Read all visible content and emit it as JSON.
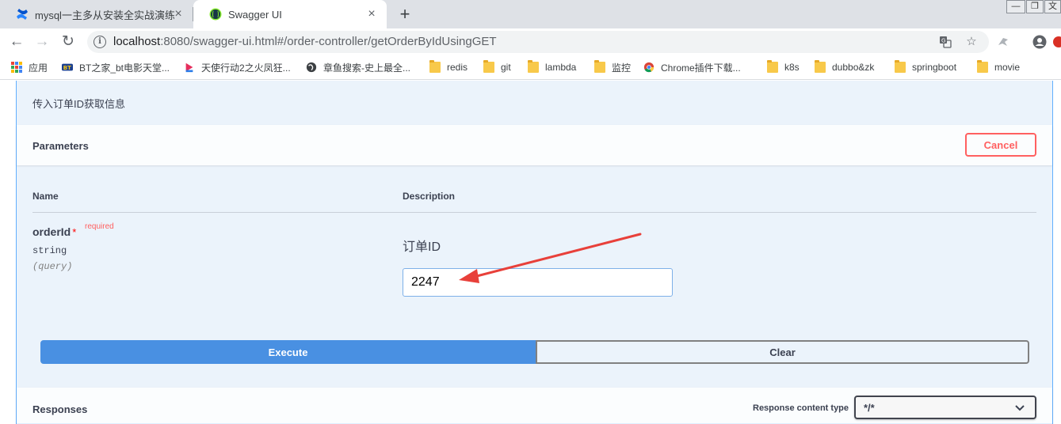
{
  "browser": {
    "tabs": [
      {
        "title": "mysql一主多从安装全实战演练 -",
        "active": false
      },
      {
        "title": "Swagger UI",
        "active": true
      }
    ],
    "window_controls": [
      "—",
      "❐",
      "文"
    ],
    "url": {
      "host": "localhost",
      "rest": ":8080/swagger-ui.html#/order-controller/getOrderByIdUsingGET"
    },
    "bookmarks": [
      {
        "label": "应用",
        "icon": "apps-icon"
      },
      {
        "label": "BT之家_bt电影天堂...",
        "icon": "bt-icon"
      },
      {
        "label": "天使行动2之火凤狂...",
        "icon": "video-icon"
      },
      {
        "label": "章鱼搜索-史上最全...",
        "icon": "globe-icon"
      },
      {
        "label": "redis",
        "icon": "folder-icon"
      },
      {
        "label": "git",
        "icon": "folder-icon"
      },
      {
        "label": "lambda",
        "icon": "folder-icon"
      },
      {
        "label": "监控",
        "icon": "folder-icon"
      },
      {
        "label": "Chrome插件下载...",
        "icon": "chrome-icon"
      },
      {
        "label": "k8s",
        "icon": "folder-icon"
      },
      {
        "label": "dubbo&zk",
        "icon": "folder-icon"
      },
      {
        "label": "springboot",
        "icon": "folder-icon"
      },
      {
        "label": "movie",
        "icon": "folder-icon"
      }
    ]
  },
  "operation": {
    "description": "传入订单ID获取信息",
    "parameters_title": "Parameters",
    "cancel_label": "Cancel",
    "columns": {
      "name": "Name",
      "description": "Description"
    },
    "param": {
      "name": "orderId",
      "required_star": "*",
      "required_label": "required",
      "type": "string",
      "in": "(query)",
      "description": "订单ID",
      "value": "2247"
    },
    "execute_label": "Execute",
    "clear_label": "Clear",
    "responses_title": "Responses",
    "response_content_type_label": "Response content type",
    "response_content_type_value": "*/*"
  },
  "colors": {
    "get_blue": "#61affe",
    "opblock_bg": "#ebf3fb",
    "execute_blue": "#4990e2",
    "cancel_red": "#ff6060",
    "annotation_arrow": "#e8403a"
  }
}
